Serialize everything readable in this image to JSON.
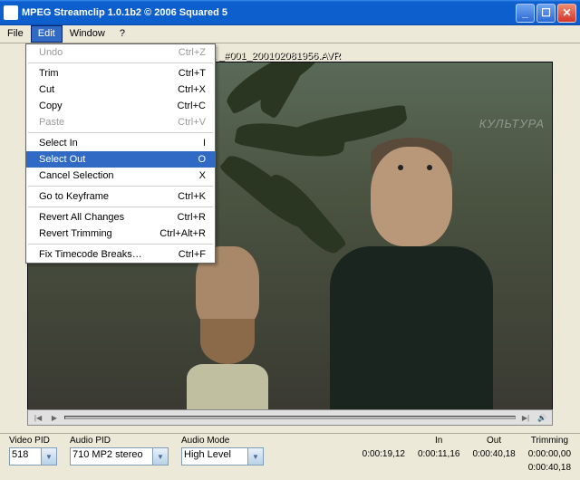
{
  "window": {
    "title": "MPEG Streamclip 1.0.1b2    ©   2006  Squared 5"
  },
  "menubar": {
    "items": [
      "File",
      "Edit",
      "Window",
      "?"
    ],
    "open_index": 1
  },
  "dropdown": {
    "groups": [
      [
        {
          "label": "Undo",
          "shortcut": "Ctrl+Z",
          "disabled": true
        }
      ],
      [
        {
          "label": "Trim",
          "shortcut": "Ctrl+T"
        },
        {
          "label": "Cut",
          "shortcut": "Ctrl+X"
        },
        {
          "label": "Copy",
          "shortcut": "Ctrl+C"
        },
        {
          "label": "Paste",
          "shortcut": "Ctrl+V",
          "disabled": true
        }
      ],
      [
        {
          "label": "Select In",
          "shortcut": "I"
        },
        {
          "label": "Select Out",
          "shortcut": "O",
          "highlight": true
        },
        {
          "label": "Cancel Selection",
          "shortcut": "X"
        }
      ],
      [
        {
          "label": "Go to Keyframe",
          "shortcut": "Ctrl+K"
        }
      ],
      [
        {
          "label": "Revert All Changes",
          "shortcut": "Ctrl+R"
        },
        {
          "label": "Revert Trimming",
          "shortcut": "Ctrl+Alt+R"
        }
      ],
      [
        {
          "label": "Fix Timecode Breaks…",
          "shortcut": "Ctrl+F"
        }
      ]
    ]
  },
  "filepath": "n-1 _#001_200102081956.AVR",
  "watermark": "КУЛЬТУРА",
  "status": {
    "video_pid": {
      "label": "Video PID",
      "value": "518"
    },
    "audio_pid": {
      "label": "Audio PID",
      "value": "710 MP2 stereo"
    },
    "audio_mode": {
      "label": "Audio Mode",
      "value": "High Level"
    },
    "current": "0:00:19,12",
    "in": {
      "label": "In",
      "value": "0:00:11,16"
    },
    "out": {
      "label": "Out",
      "value": "0:00:40,18"
    },
    "trimming": {
      "label": "Trimming",
      "top": "0:00:00,00",
      "bottom": "0:00:40,18"
    }
  }
}
